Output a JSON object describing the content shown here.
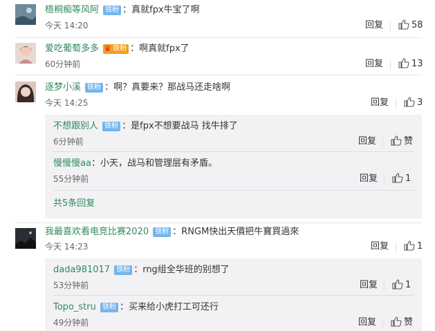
{
  "comments": [
    {
      "name": "梧桐痴等风阿",
      "badge": "铁粉",
      "text": "：真就fpx牛宝了啊",
      "time": "今天 14:20",
      "reply": "回复",
      "likes": "58"
    },
    {
      "name": "爱吃葡萄多多",
      "badge": "铁粉",
      "text": "：啊真就fpx了",
      "time": "60分钟前",
      "reply": "回复",
      "likes": "13"
    },
    {
      "name": "逐梦小溪",
      "badge": "铁粉",
      "text": "：啊？真要来？那战马还走啥啊",
      "time": "今天 14:25",
      "reply": "回复",
      "likes": "3",
      "replies": [
        {
          "name": "不想跟别人",
          "badge": "铁粉",
          "text": "：是fpx不想要战马 找牛排了",
          "time": "6分钟前",
          "reply": "回复",
          "likes": "赞"
        },
        {
          "name": "慢慢慢aa",
          "badge": "",
          "text": "：小天，战马和管理层有矛盾。",
          "time": "55分钟前",
          "reply": "回复",
          "likes": "1"
        }
      ],
      "more": "共5条回复"
    },
    {
      "name": "我最喜欢看电竞比赛2020",
      "badge": "铁粉",
      "text": "：RNGM快出天價把牛寶買過來",
      "time": "今天 14:23",
      "reply": "回复",
      "likes": "1",
      "replies": [
        {
          "name": "dada981017",
          "badge": "铁粉",
          "text": "：rng组全华班的别想了",
          "time": "53分钟前",
          "reply": "回复",
          "likes": "1"
        },
        {
          "name": "Topo_stru",
          "badge": "铁粉",
          "text": "：买来给小虎打工可还行",
          "time": "49分钟前",
          "reply": "回复",
          "likes": "赞"
        }
      ]
    }
  ]
}
